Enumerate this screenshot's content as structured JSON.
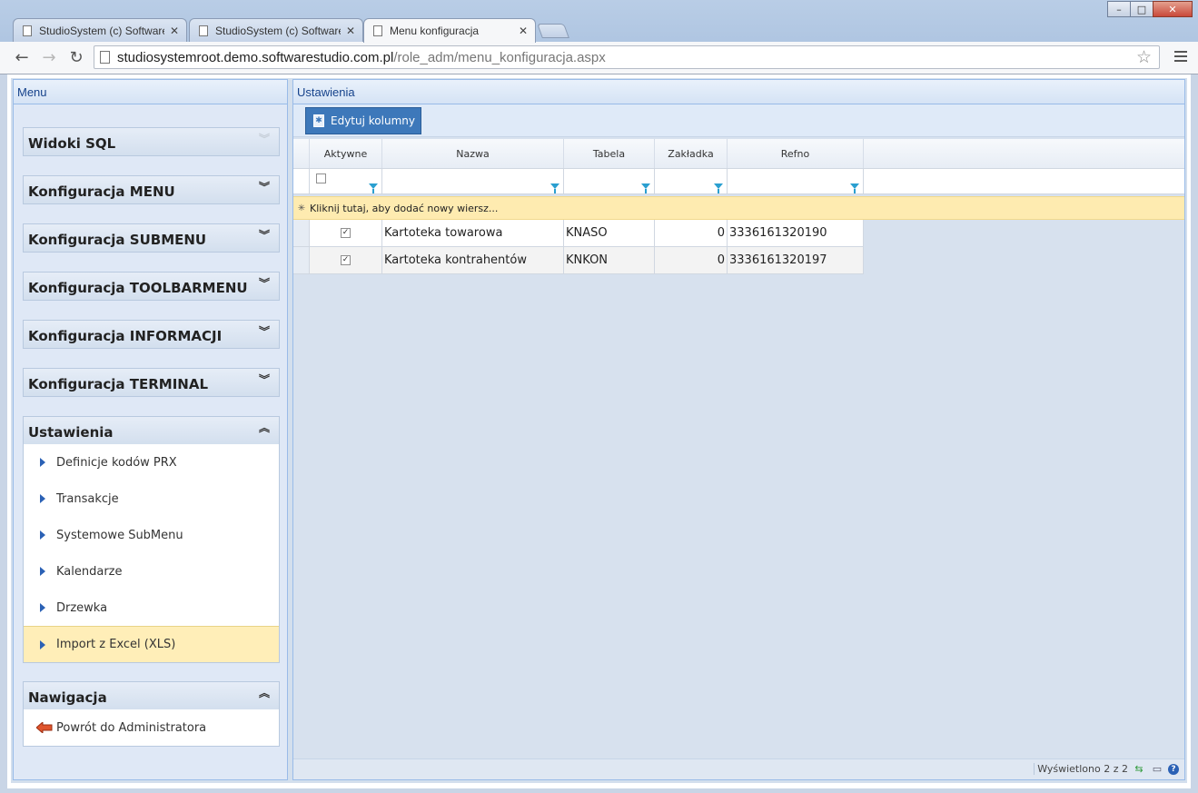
{
  "browser": {
    "tabs": [
      {
        "title": "StudioSystem (c) Software",
        "active": false
      },
      {
        "title": "StudioSystem (c) Software",
        "active": false
      },
      {
        "title": "Menu konfiguracja",
        "active": true
      }
    ],
    "url_host": "studiosystemroot.demo.softwarestudio.com.pl",
    "url_path": "/role_adm/menu_konfiguracja.aspx"
  },
  "menu": {
    "title": "Menu",
    "groups": [
      {
        "label": "Widoki SQL",
        "expanded": false
      },
      {
        "label": "Konfiguracja MENU",
        "expanded": false
      },
      {
        "label": "Konfiguracja SUBMENU",
        "expanded": false
      },
      {
        "label": "Konfiguracja TOOLBARMENU",
        "expanded": false
      },
      {
        "label": "Konfiguracja INFORMACJI",
        "expanded": false
      },
      {
        "label": "Konfiguracja TERMINAL",
        "expanded": false
      },
      {
        "label": "Ustawienia",
        "expanded": true,
        "items": [
          {
            "label": "Definicje kodów PRX"
          },
          {
            "label": "Transakcje"
          },
          {
            "label": "Systemowe SubMenu"
          },
          {
            "label": "Kalendarze"
          },
          {
            "label": "Drzewka"
          },
          {
            "label": "Import z Excel (XLS)",
            "selected": true
          }
        ]
      },
      {
        "label": "Nawigacja",
        "expanded": true,
        "items": [
          {
            "label": "Powrót do Administratora"
          }
        ]
      }
    ]
  },
  "settings": {
    "title": "Ustawienia",
    "edit_columns_label": "Edytuj kolumny",
    "columns": [
      "Aktywne",
      "Nazwa",
      "Tabela",
      "Zakładka",
      "Refno"
    ],
    "add_row_label": "Kliknij tutaj, aby dodać nowy wiersz...",
    "rows": [
      {
        "aktywne": true,
        "nazwa": "Kartoteka towarowa",
        "tabela": "KNASO",
        "zakladka": "0",
        "refno": "3336161320190"
      },
      {
        "aktywne": true,
        "nazwa": "Kartoteka kontrahentów",
        "tabela": "KNKON",
        "zakladka": "0",
        "refno": "3336161320197"
      }
    ],
    "status": "Wyświetlono 2 z 2"
  },
  "colors": {
    "accent": "#3d78ba",
    "panel_header_text": "#15428b",
    "selected_item": "#ffeeb8",
    "filter_icon": "#2a9fd0"
  }
}
